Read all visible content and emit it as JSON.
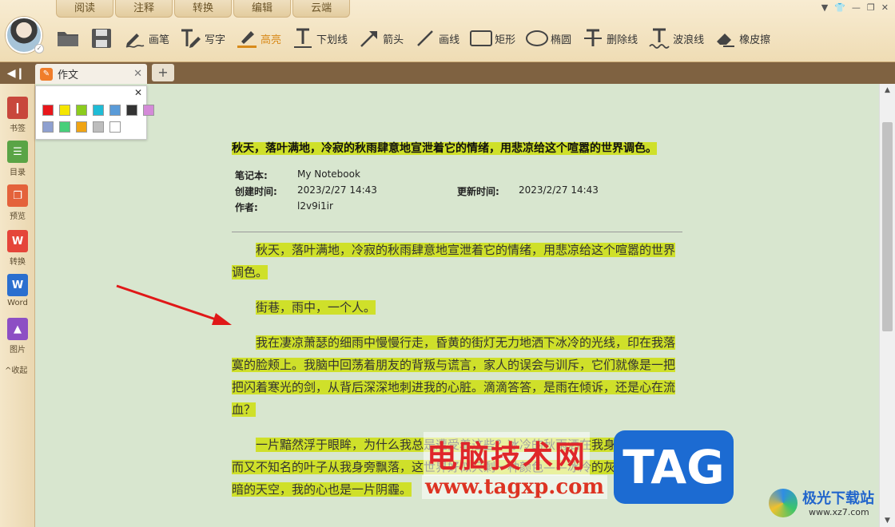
{
  "menu_tabs": [
    "阅读",
    "注释",
    "转换",
    "编辑",
    "云端"
  ],
  "tools": [
    {
      "name": "open-folder",
      "label": ""
    },
    {
      "name": "save",
      "label": ""
    },
    {
      "name": "pen",
      "label": "画笔"
    },
    {
      "name": "write",
      "label": "写字"
    },
    {
      "name": "highlight",
      "label": "高亮"
    },
    {
      "name": "underline",
      "label": "下划线"
    },
    {
      "name": "arrow",
      "label": "箭头"
    },
    {
      "name": "line",
      "label": "画线"
    },
    {
      "name": "rectangle",
      "label": "矩形"
    },
    {
      "name": "ellipse",
      "label": "椭圆"
    },
    {
      "name": "strikethrough",
      "label": "删除线"
    },
    {
      "name": "wavy-line",
      "label": "波浪线"
    },
    {
      "name": "eraser",
      "label": "橡皮擦"
    }
  ],
  "active_tool": "highlight",
  "accent_color": "#d88a1a",
  "tab": {
    "title": "作文"
  },
  "sidebar": [
    {
      "label": "书签",
      "color": "#c8473c",
      "glyph": "❙"
    },
    {
      "label": "目录",
      "color": "#5aa446",
      "glyph": "☰"
    },
    {
      "label": "预览",
      "color": "#e4623b",
      "glyph": "❐"
    },
    {
      "label": "转换",
      "color": "#e5453a",
      "glyph": "W"
    },
    {
      "label": "Word",
      "color": "#2b6fcf",
      "glyph": "W"
    },
    {
      "label": "图片",
      "color": "#8d4fc4",
      "glyph": "▲"
    }
  ],
  "sidebar_fold": "^收起",
  "palette_colors": [
    "#e8161b",
    "#f5e600",
    "#8ccc1d",
    "#1fbcd6",
    "#5a9bd8",
    "#333333",
    "#d48ad8",
    "#8ea0d0",
    "#48cf7a",
    "#f0a413",
    "#bdbdbd",
    "#ffffff"
  ],
  "highlight_color": "#cfe02a",
  "document": {
    "title": "秋天，落叶满地，冷寂的秋雨肆意地宣泄着它的情绪，用悲凉给这个喧嚣的世界调色。",
    "notebook_label": "笔记本:",
    "notebook_value": "My Notebook",
    "created_label": "创建时间:",
    "created_value": "2023/2/27 14:43",
    "updated_label": "更新时间:",
    "updated_value": "2023/2/27 14:43",
    "author_label": "作者:",
    "author_value": "l2v9i1ir",
    "paragraphs": [
      "秋天，落叶满地，冷寂的秋雨肆意地宣泄着它的情绪，用悲凉给这个喧嚣的世界调色。",
      "街巷，雨中，一个人。",
      "我在凄凉萧瑟的细雨中慢慢行走，昏黄的街灯无力地洒下冰冷的光线，印在我落寞的脸颊上。我脑中回荡着朋友的背叛与谎言，家人的误会与训斥，它们就像是一把把闪着寒光的剑，从背后深深地刺进我的心脏。滴滴答答，是雨在倾诉，还是心在流血？",
      "一片黯然浮于眼眸，为什么我总是遭受着这些？冰冷的秋雨洒在我身上，任枯黄而又不知名的叶子从我身旁飘落，这世界好似只剩一种颜色——冰冷的灰色。望向灰暗的天空，我的心也是一片阴霾。"
    ]
  },
  "watermark": {
    "site_cn": "电脑技术网",
    "site_url": "www.tagxp.com",
    "tag": "TAG",
    "brand2_title": "极光下载站",
    "brand2_url": "www.xz7.com"
  }
}
